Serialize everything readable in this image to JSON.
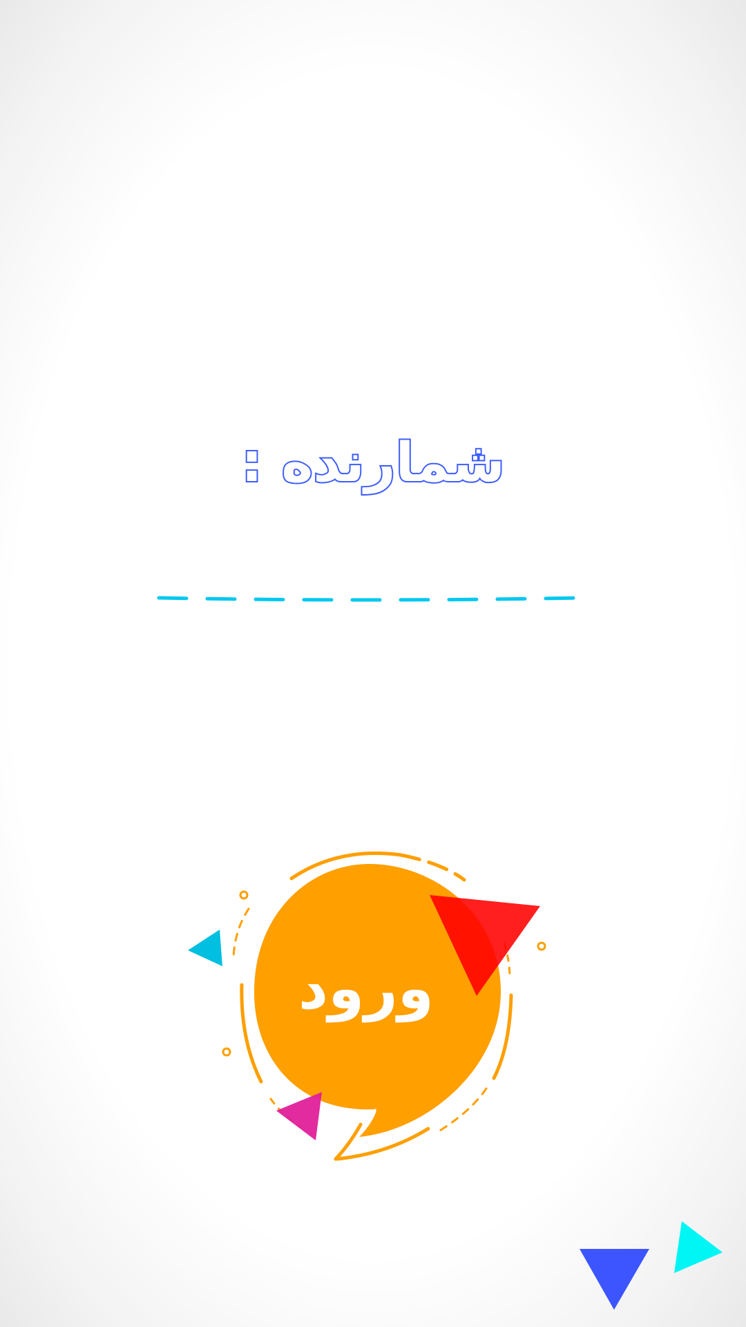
{
  "screen": {
    "title": "شمارنده :",
    "number_field": {
      "value": "",
      "placeholder": ""
    },
    "login_button": {
      "label": "ورود"
    }
  },
  "colors": {
    "title_outline": "#3d5cff",
    "field_underline": "#00c8f0",
    "bubble": "#ff9f00",
    "triangle_red": "#ff0000",
    "triangle_pink": "#e0209a",
    "triangle_cyan_small": "#00bfe0",
    "triangle_blue": "#3d55ff",
    "triangle_cyan": "#00f5f5"
  }
}
